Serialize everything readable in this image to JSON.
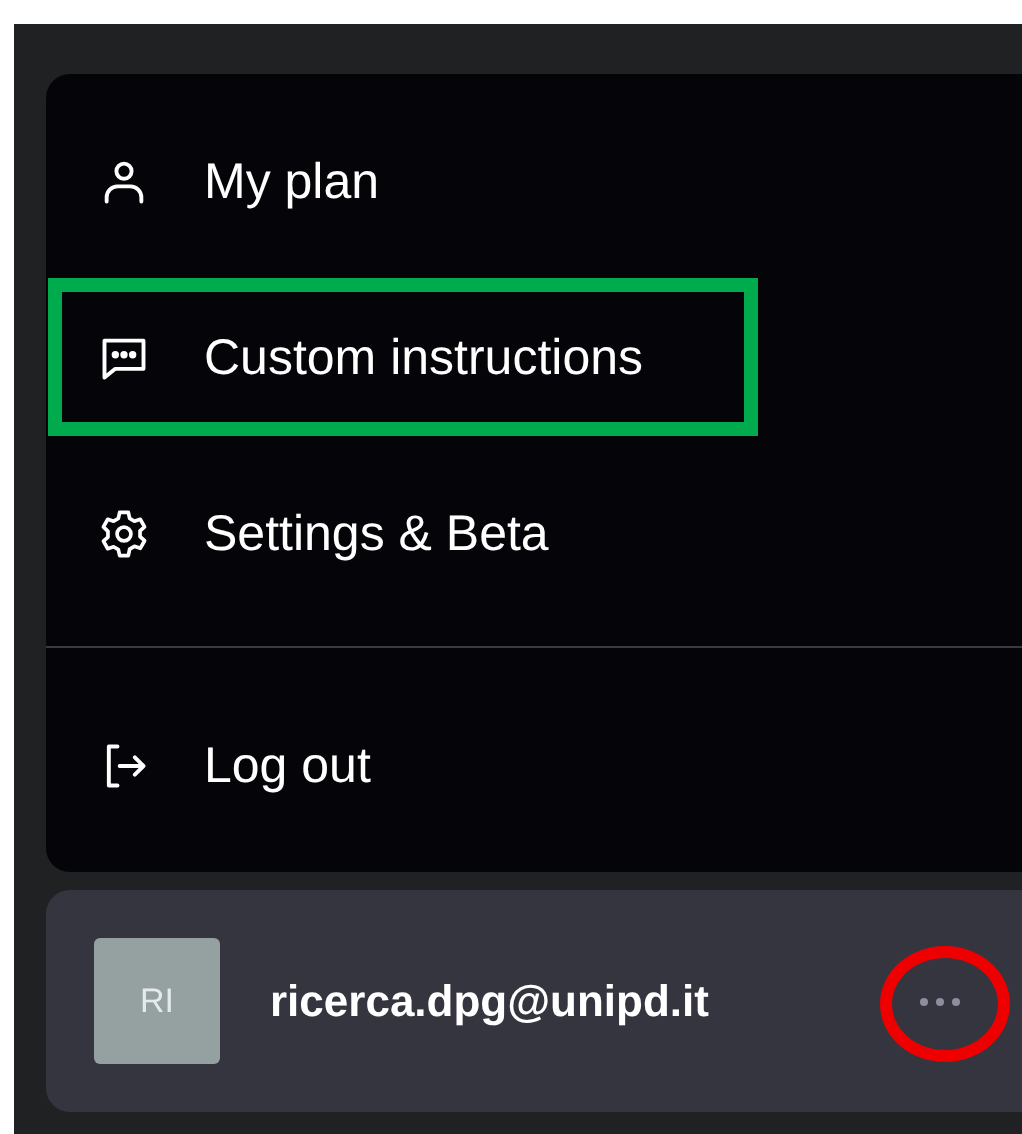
{
  "menu": {
    "sections": [
      {
        "items": [
          {
            "label": "My plan",
            "kind": "person",
            "highlighted": false
          },
          {
            "label": "Custom instructions",
            "kind": "chat",
            "highlighted": true
          },
          {
            "label": "Settings & Beta",
            "kind": "gear",
            "highlighted": false
          }
        ]
      },
      {
        "items": [
          {
            "label": "Log out",
            "kind": "logout",
            "highlighted": false
          }
        ]
      }
    ]
  },
  "account": {
    "avatar": "RI",
    "email": "ricerca.dpg@unipd.it",
    "more_circled": true
  }
}
